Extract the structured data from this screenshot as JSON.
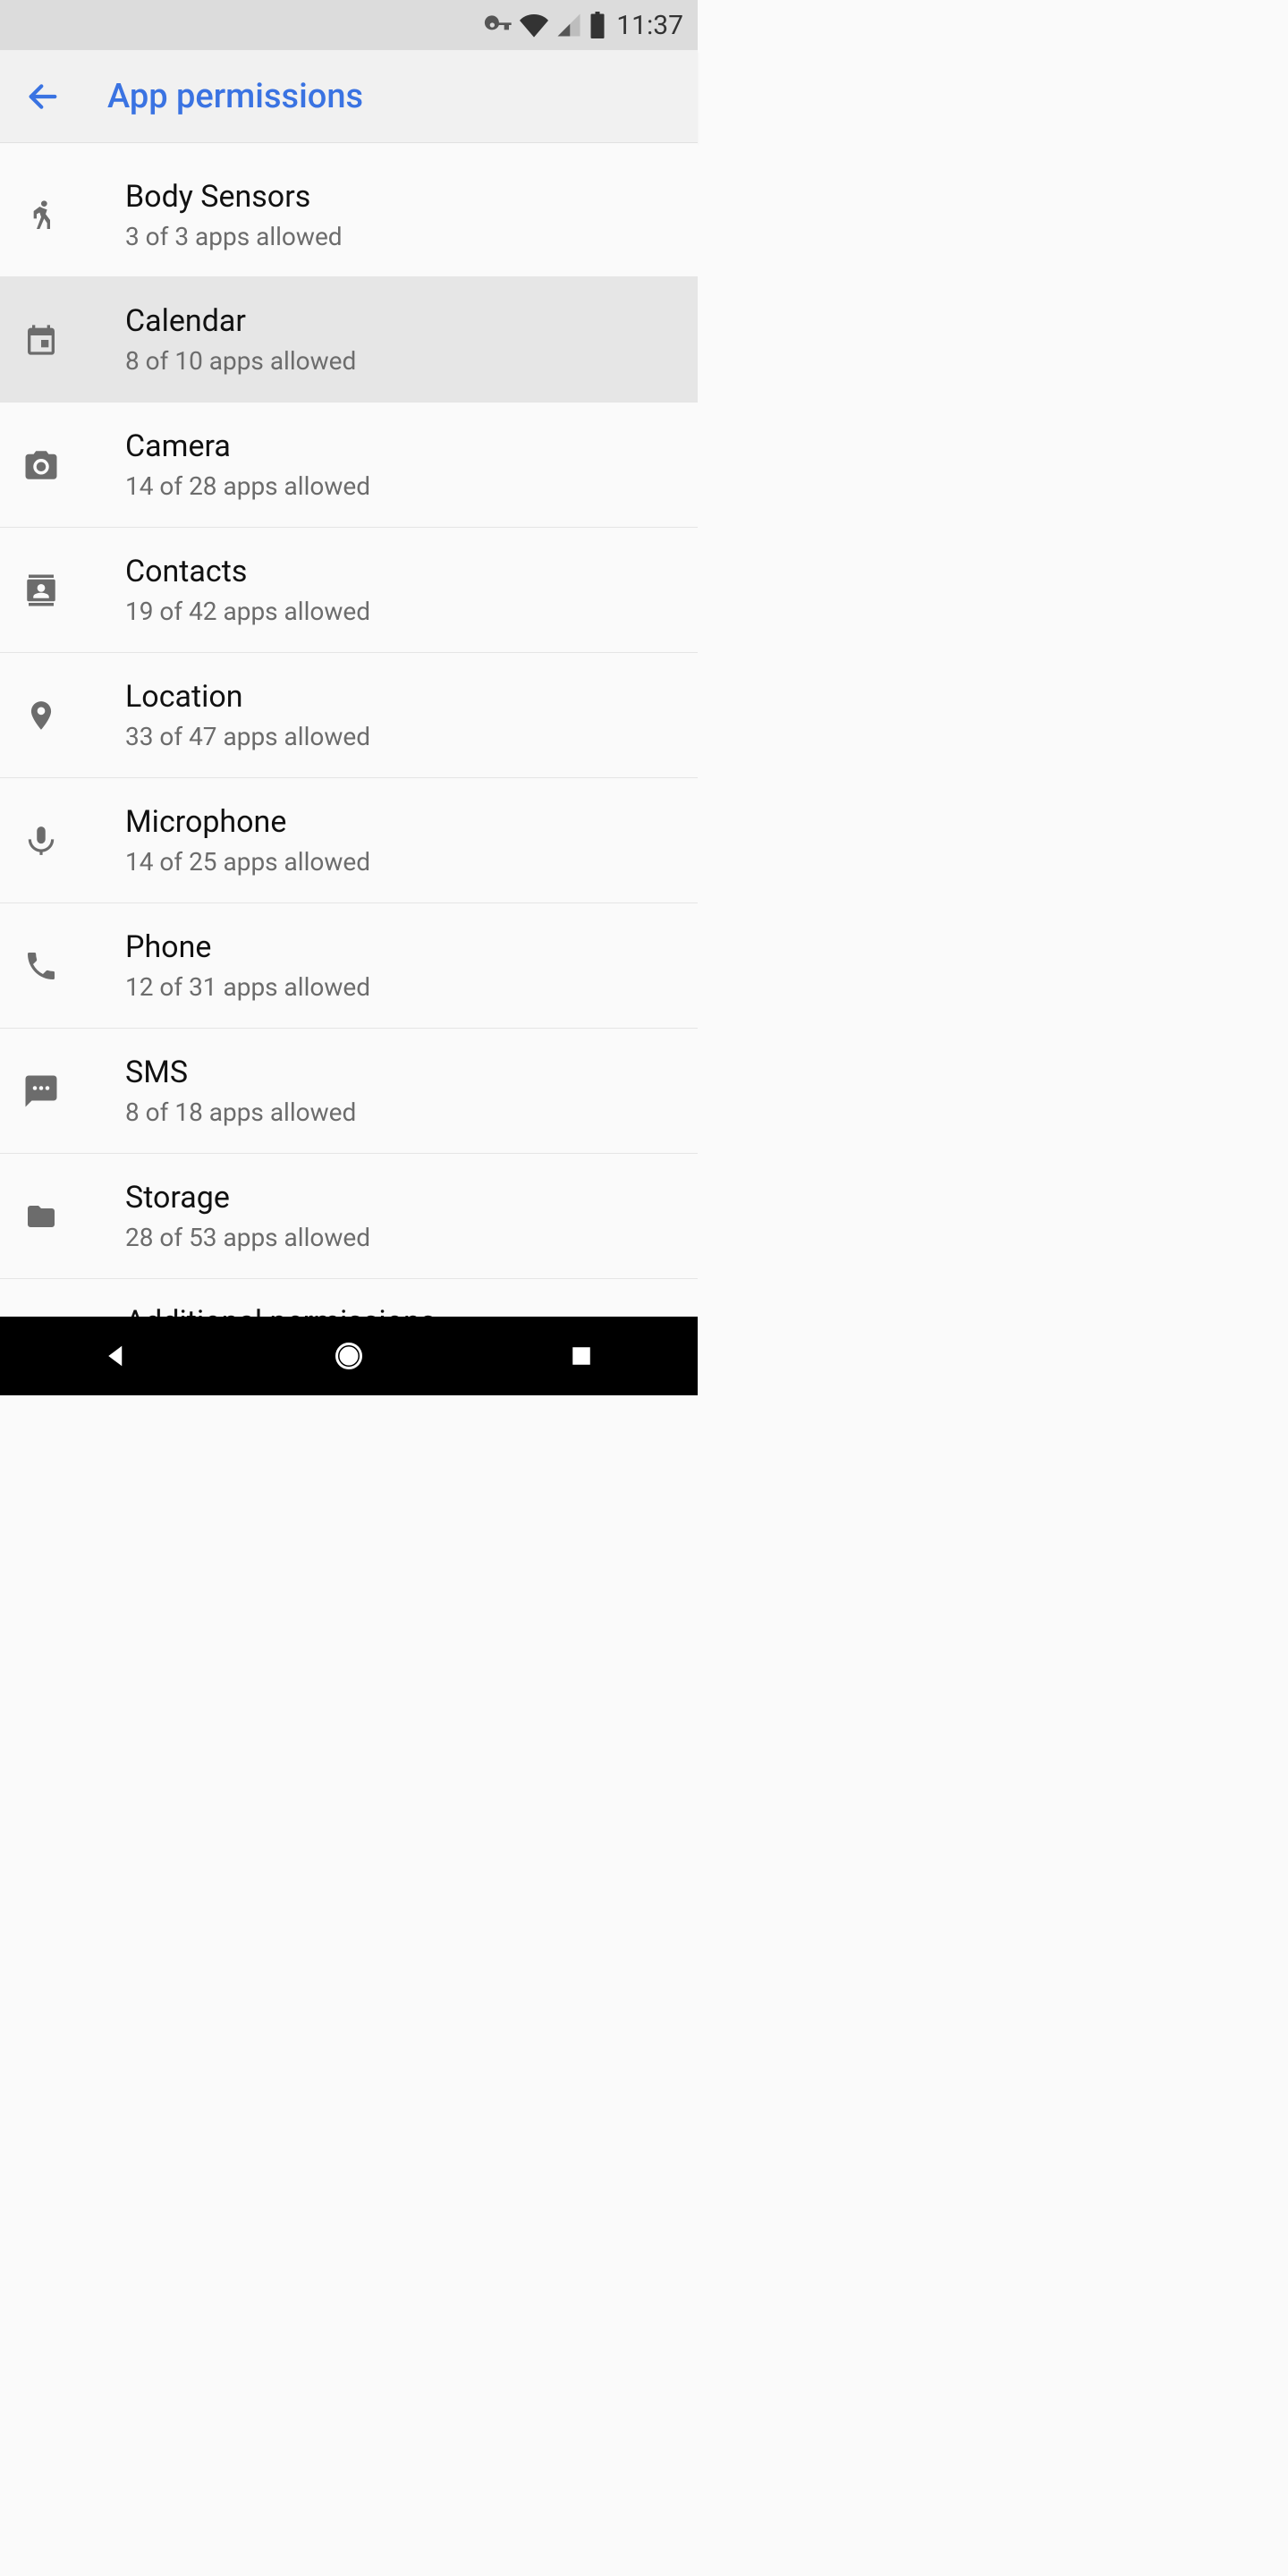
{
  "status_bar": {
    "clock": "11:37"
  },
  "app_bar": {
    "title": "App permissions"
  },
  "rows": [
    {
      "title": "Body Sensors",
      "sub": "3 of 3 apps allowed"
    },
    {
      "title": "Calendar",
      "sub": "8 of 10 apps allowed"
    },
    {
      "title": "Camera",
      "sub": "14 of 28 apps allowed"
    },
    {
      "title": "Contacts",
      "sub": "19 of 42 apps allowed"
    },
    {
      "title": "Location",
      "sub": "33 of 47 apps allowed"
    },
    {
      "title": "Microphone",
      "sub": "14 of 25 apps allowed"
    },
    {
      "title": "Phone",
      "sub": "12 of 31 apps allowed"
    },
    {
      "title": "SMS",
      "sub": "8 of 18 apps allowed"
    },
    {
      "title": "Storage",
      "sub": "28 of 53 apps allowed"
    }
  ],
  "partial_row": {
    "title": "Additional permissions"
  }
}
